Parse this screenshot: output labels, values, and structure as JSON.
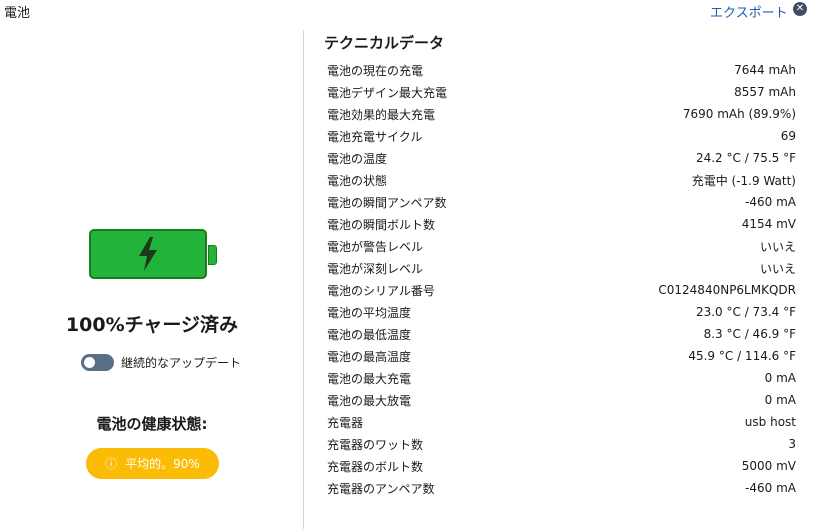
{
  "header": {
    "title": "電池",
    "export_label": "エクスポート",
    "close_symbol": "✕"
  },
  "battery": {
    "icon": "charging-bolt-icon",
    "charge_text": "100%チャージ済み",
    "continuous_update": {
      "label": "継続的なアップデート",
      "enabled": false
    },
    "health_title": "電池の健康状態:",
    "health_status": "平均的。90%",
    "health_icon": "warning-icon",
    "colors": {
      "battery_fill": "#22b33a",
      "badge": "#fbbc05",
      "link": "#1a5fb4"
    }
  },
  "technical": {
    "title": "テクニカルデータ",
    "rows": [
      {
        "label": "電池の現在の充電",
        "value": "7644 mAh"
      },
      {
        "label": "電池デザイン最大充電",
        "value": "8557 mAh"
      },
      {
        "label": "電池効果的最大充電",
        "value": "7690 mAh (89.9%)"
      },
      {
        "label": "電池充電サイクル",
        "value": "69"
      },
      {
        "label": "電池の温度",
        "value": "24.2 °C / 75.5 °F"
      },
      {
        "label": "電池の状態",
        "value": "充電中 (-1.9 Watt)"
      },
      {
        "label": "電池の瞬間アンペア数",
        "value": "-460 mA"
      },
      {
        "label": "電池の瞬間ボルト数",
        "value": "4154 mV"
      },
      {
        "label": "電池が警告レベル",
        "value": "いいえ"
      },
      {
        "label": "電池が深刻レベル",
        "value": "いいえ"
      },
      {
        "label": "電池のシリアル番号",
        "value": "C0124840NP6LMKQDR"
      },
      {
        "label": "電池の平均温度",
        "value": "23.0 °C / 73.4 °F"
      },
      {
        "label": "電池の最低温度",
        "value": "8.3 °C / 46.9 °F"
      },
      {
        "label": "電池の最高温度",
        "value": "45.9 °C / 114.6 °F"
      },
      {
        "label": "電池の最大充電",
        "value": "0 mA"
      },
      {
        "label": "電池の最大放電",
        "value": "0 mA"
      },
      {
        "label": "充電器",
        "value": "usb host"
      },
      {
        "label": "充電器のワット数",
        "value": "3"
      },
      {
        "label": "充電器のボルト数",
        "value": "5000 mV"
      },
      {
        "label": "充電器のアンペア数",
        "value": "-460 mA"
      }
    ]
  }
}
